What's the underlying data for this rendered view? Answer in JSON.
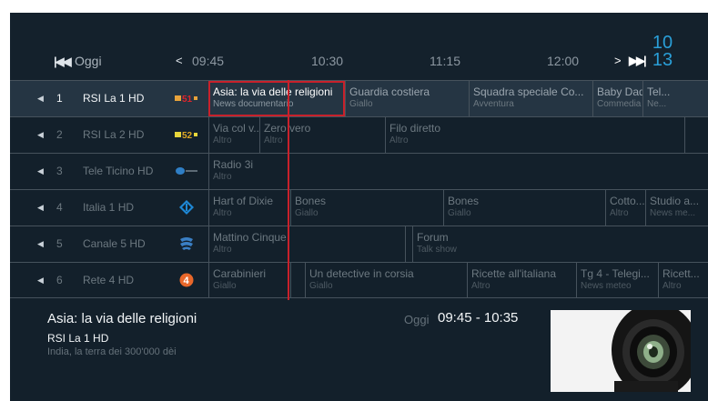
{
  "header": {
    "nav_first": "K",
    "day": "Oggi",
    "nav_prev": "<",
    "times": [
      "09:45",
      "10:30",
      "11:15",
      "12:00"
    ],
    "nav_next": ">",
    "nav_last": "»",
    "date_top": "10",
    "date_bottom": "13"
  },
  "channels": [
    {
      "arrow": "◀",
      "number": "1",
      "name": "RSI La 1 HD",
      "logo": "rsi-la1-logo",
      "programs": [
        {
          "title": "Asia: la via delle religioni",
          "genre": "News documentario",
          "focused": true
        },
        {
          "title": "Guardia costiera",
          "genre": "Giallo"
        },
        {
          "title": "Squadra speciale Co...",
          "genre": "Avventura"
        },
        {
          "title": "Baby Daddy",
          "genre": "Commedia"
        },
        {
          "title": "Tel...",
          "genre": "Ne..."
        }
      ]
    },
    {
      "arrow": "◀",
      "number": "2",
      "name": "RSI La 2 HD",
      "logo": "rsi-la2-logo",
      "programs": [
        {
          "title": "Via col v...",
          "genre": "Altro"
        },
        {
          "title": "Zero vero",
          "genre": "Altro"
        },
        {
          "title": "Filo diretto",
          "genre": "Altro"
        },
        {
          "title": "",
          "genre": ""
        }
      ]
    },
    {
      "arrow": "◀",
      "number": "3",
      "name": "Tele Ticino HD",
      "logo": "teleticino-logo",
      "programs": [
        {
          "title": "Radio 3i",
          "genre": "Altro"
        }
      ]
    },
    {
      "arrow": "◀",
      "number": "4",
      "name": "Italia 1 HD",
      "logo": "italia1-logo",
      "programs": [
        {
          "title": "Hart of Dixie",
          "genre": "Altro"
        },
        {
          "title": "Bones",
          "genre": "Giallo"
        },
        {
          "title": "Bones",
          "genre": "Giallo"
        },
        {
          "title": "Cotto...",
          "genre": "Altro"
        },
        {
          "title": "Studio a...",
          "genre": "News me..."
        }
      ]
    },
    {
      "arrow": "◀",
      "number": "5",
      "name": "Canale 5 HD",
      "logo": "canale5-logo",
      "programs": [
        {
          "title": "Mattino Cinque",
          "genre": "Altro"
        },
        {
          "title": "",
          "genre": ""
        },
        {
          "title": "Forum",
          "genre": "Talk show"
        }
      ]
    },
    {
      "arrow": "◀",
      "number": "6",
      "name": "Rete 4 HD",
      "logo": "rete4-logo",
      "programs": [
        {
          "title": "Carabinieri",
          "genre": "Giallo"
        },
        {
          "title": "",
          "genre": ""
        },
        {
          "title": "Un detective in corsia",
          "genre": "Giallo"
        },
        {
          "title": "Ricette all'italiana",
          "genre": "Altro"
        },
        {
          "title": "Tg 4 - Telegi...",
          "genre": "News meteo"
        },
        {
          "title": "Ricett...",
          "genre": "Altro"
        }
      ]
    }
  ],
  "info": {
    "title": "Asia: la via delle religioni",
    "channel": "RSI La 1 HD",
    "description": "India, la terra dei 300'000 dèi",
    "day": "Oggi",
    "time": "09:45 - 10:35"
  },
  "colors": {
    "background": "#13202b",
    "focus_border": "#c8212b",
    "now_line": "#c8212b",
    "date_accent": "#2a9fd8"
  }
}
